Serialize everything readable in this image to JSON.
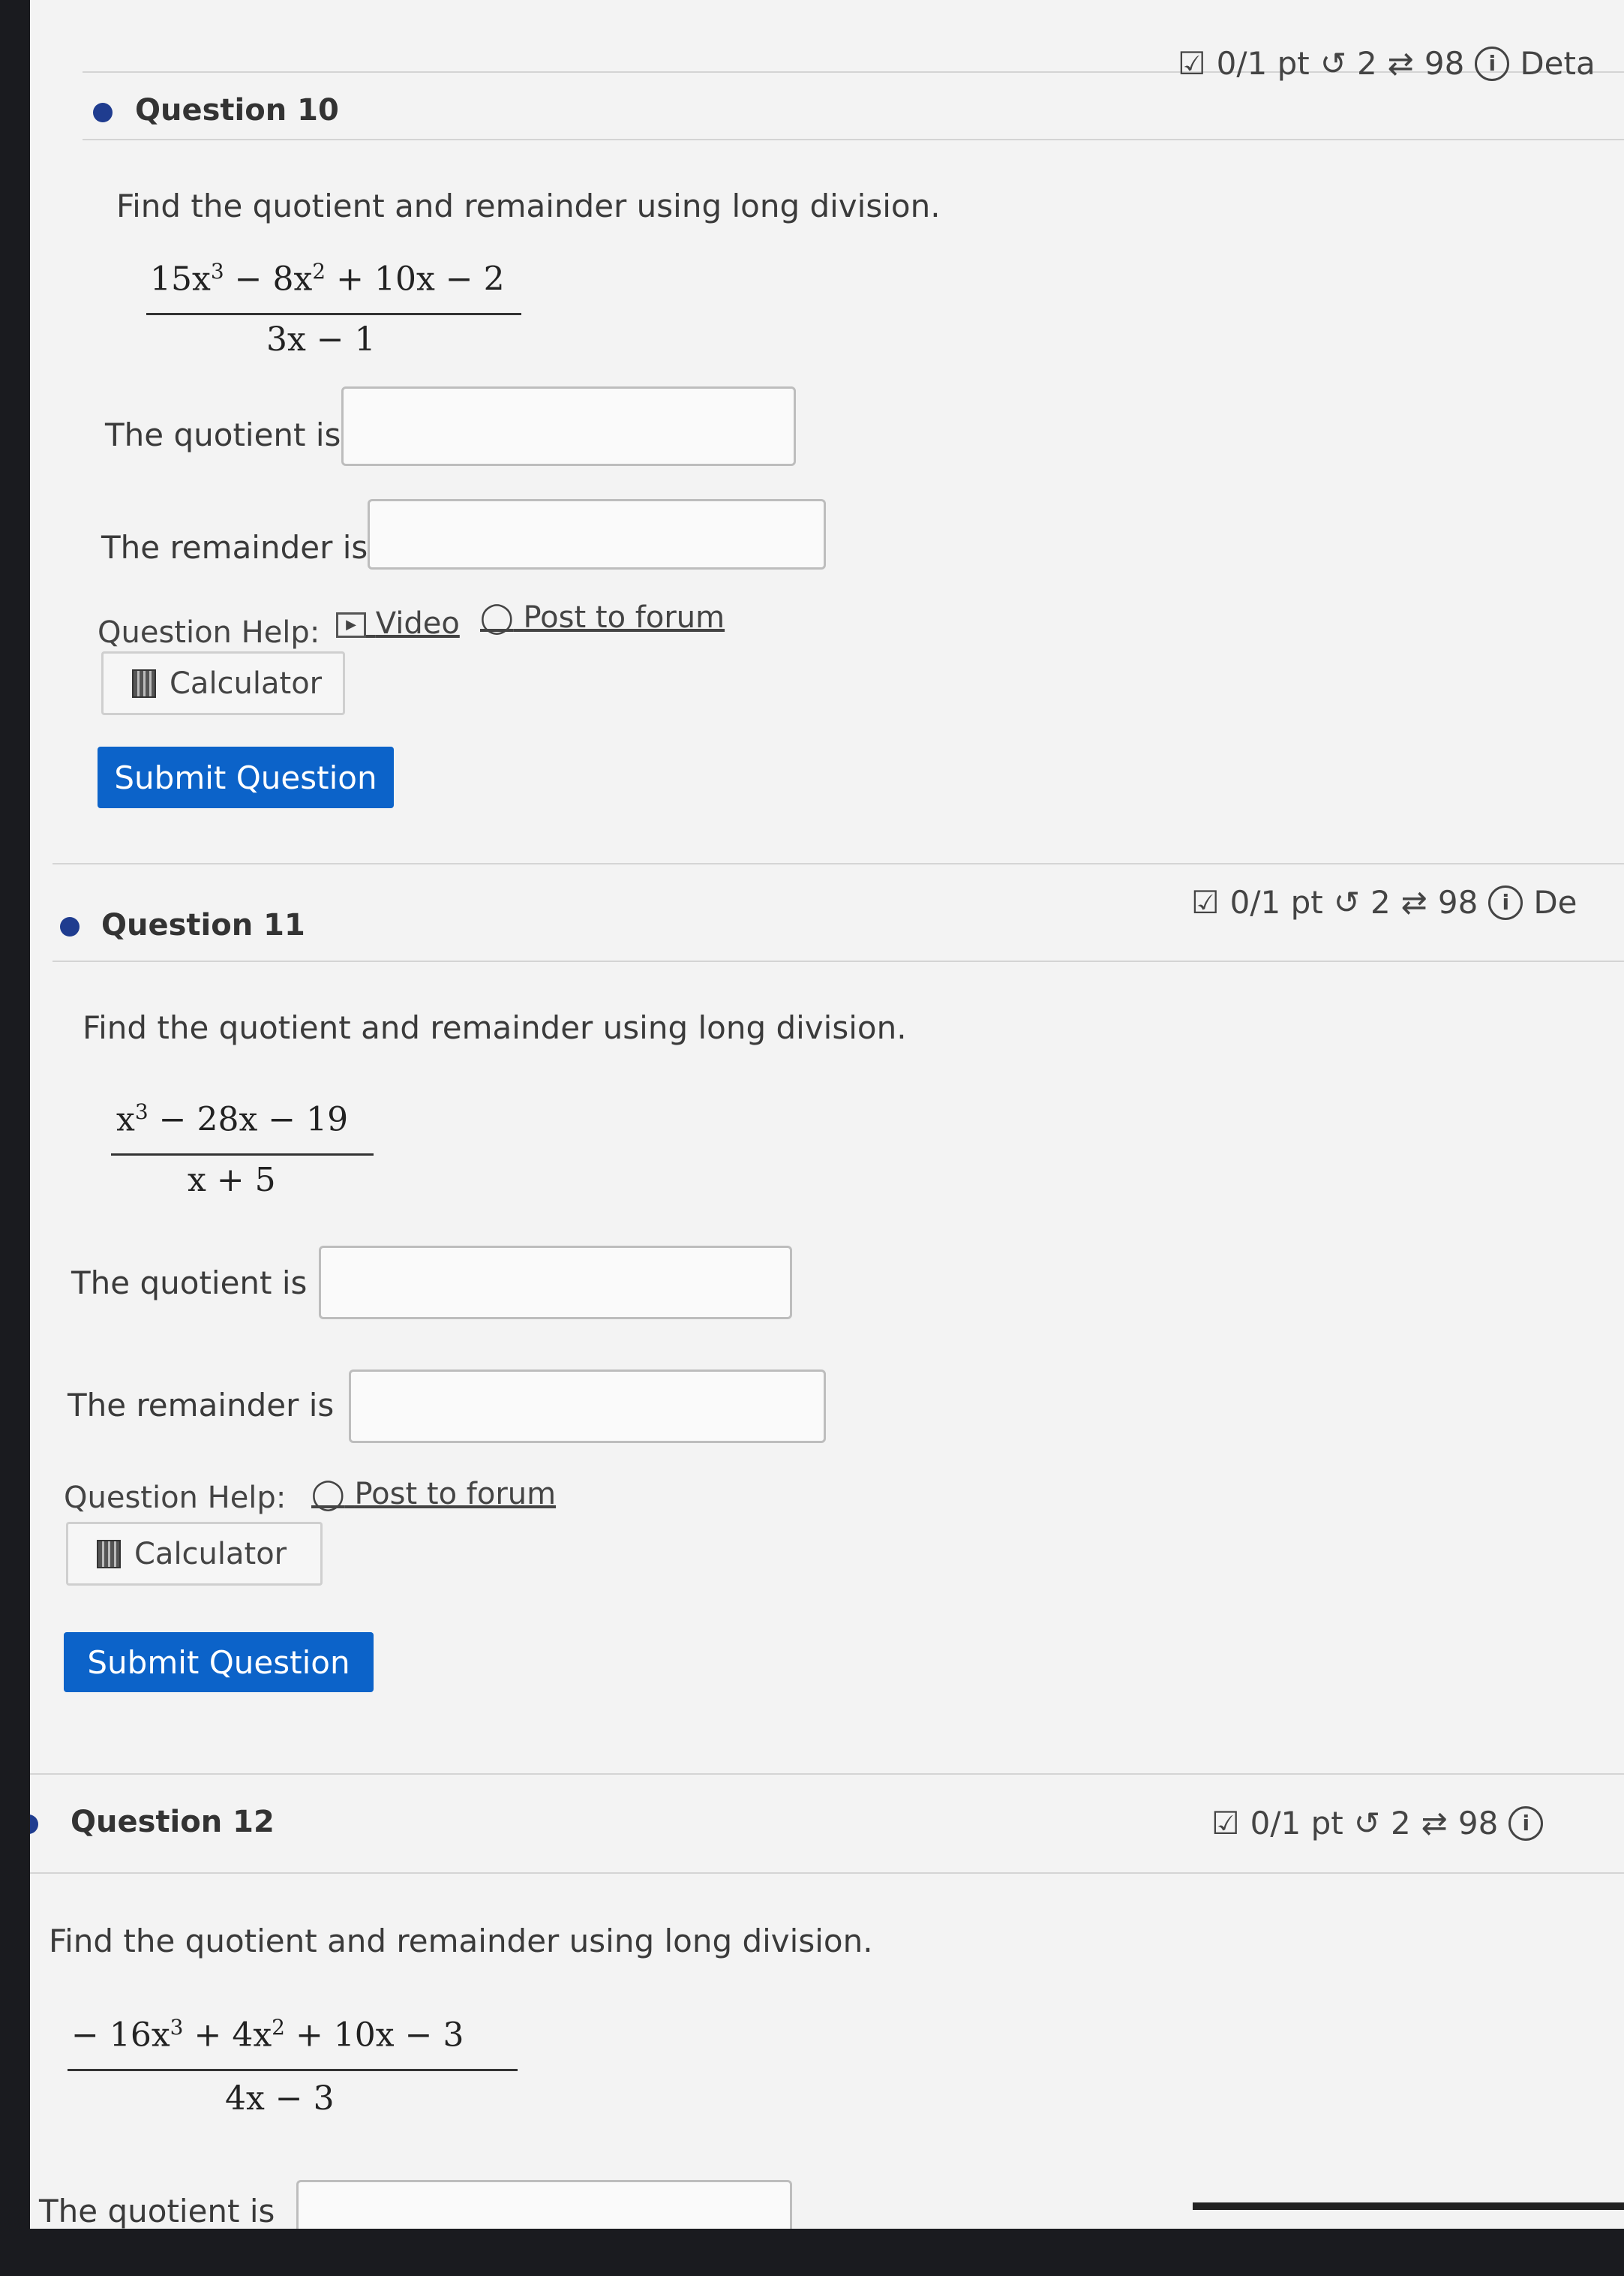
{
  "questions": [
    {
      "title": "Question 10",
      "score": "0/1 pt",
      "retries": "2",
      "attempts": "98",
      "details": "Deta",
      "prompt": "Find the quotient and remainder using long division.",
      "numerator": [
        "15x",
        "3",
        " − 8x",
        "2",
        " + 10x − 2"
      ],
      "denominator": "3x − 1",
      "quotient_label": "The quotient is",
      "remainder_label": "The remainder is",
      "help_label": "Question Help:",
      "video_label": "Video",
      "forum_label": "Post to forum",
      "calculator_label": "Calculator",
      "submit_label": "Submit Question"
    },
    {
      "title": "Question 11",
      "score": "0/1 pt",
      "retries": "2",
      "attempts": "98",
      "details": "De",
      "prompt": "Find the quotient and remainder using long division.",
      "numerator": [
        "x",
        "3",
        " − 28x − 19"
      ],
      "denominator": "x + 5",
      "quotient_label": "The quotient is",
      "remainder_label": "The remainder is",
      "help_label": "Question Help:",
      "forum_label": "Post to forum",
      "calculator_label": "Calculator",
      "submit_label": "Submit Question"
    },
    {
      "title": "Question 12",
      "score": "0/1 pt",
      "retries": "2",
      "attempts": "98",
      "prompt": "Find the quotient and remainder using long division.",
      "numerator": [
        "− 16x",
        "3",
        " + 4x",
        "2",
        " + 10x − 3"
      ],
      "denominator": "4x − 3",
      "quotient_label": "The quotient is"
    }
  ],
  "colors": {
    "accent": "#0c63c9",
    "bullet": "#1f3c8f",
    "background": "#f3f3f3"
  },
  "icons": [
    "checkbox-icon",
    "retry-icon",
    "attempts-icon",
    "info-icon",
    "video-icon",
    "comment-icon",
    "calculator-icon"
  ]
}
